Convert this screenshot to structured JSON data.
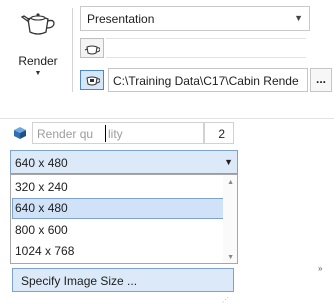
{
  "render": {
    "label": "Render"
  },
  "preset": {
    "selected": "Presentation"
  },
  "output_path": {
    "value": "C:\\Training Data\\C17\\Cabin Rende"
  },
  "browse": {
    "label": "..."
  },
  "quality": {
    "placeholder_left": "Render qu",
    "placeholder_right": "lity",
    "value": "2"
  },
  "image_size": {
    "selected": "640 x 480",
    "options": [
      "320 x 240",
      "640 x 480",
      "800 x 600",
      "1024 x 768"
    ]
  },
  "specify": {
    "label": "Specify Image Size ..."
  },
  "colors": {
    "accent": "#7da2ce",
    "selection_bg": "#cfe2f8"
  }
}
